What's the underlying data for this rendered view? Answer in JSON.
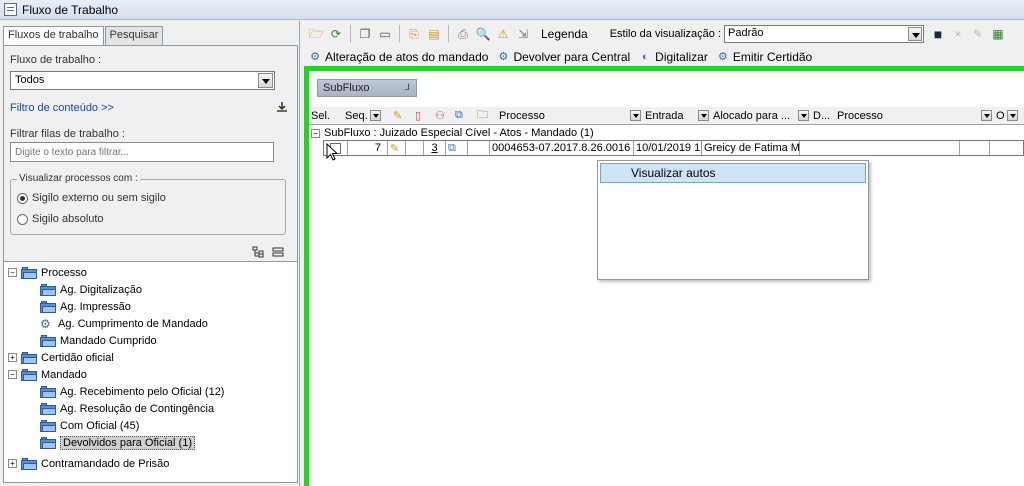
{
  "window": {
    "title": "Fluxo de Trabalho"
  },
  "left": {
    "tabs": [
      "Fluxos de trabalho",
      "Pesquisar"
    ],
    "flow_label": "Fluxo de trabalho :",
    "flow_value": "Todos",
    "content_filter_link": "Filtro de conteúdo >>",
    "filter_label": "Filtrar filas de trabalho :",
    "filter_placeholder": "Digite o texto para filtrar...",
    "visualize_group": "Visualizar processos com :",
    "radio_external": "Sigilo externo ou sem sigilo",
    "radio_absolute": "Sigilo absoluto"
  },
  "tree": {
    "processo": "Processo",
    "processo_children": [
      "Ag. Digitalização",
      "Ag. Impressão",
      "Ag. Cumprimento de Mandado",
      "Mandado Cumprido"
    ],
    "certidao": "Certidão oficial",
    "mandado": "Mandado",
    "mandado_children": [
      "Ag. Recebimento pelo Oficial (12)",
      "Ag. Resolução de Contingência",
      "Com Oficial (45)",
      "Devolvidos para Oficial (1)"
    ],
    "contramandado": "Contramandado de Prisão"
  },
  "toolbar": {
    "legend": "Legenda",
    "view_style_label": "Estilo da visualização :",
    "view_style_value": "Padrão"
  },
  "actions": [
    "Alteração de atos do mandado",
    "Devolver para Central",
    "Digitalizar",
    "Emitir Certidão"
  ],
  "grid": {
    "subflux_tab": "SubFluxo",
    "headers": {
      "sel": "Sel.",
      "seq": "Seq.",
      "processo": "Processo",
      "entrada": "Entrada",
      "alocado": "Alocado para ...",
      "d": "D...",
      "processo2": "Processo",
      "o": "O"
    },
    "group": "SubFluxo : Juizado Especial Cível - Atos - Mandado  (1)",
    "row": {
      "seq": "7",
      "docs": "3",
      "processo": "0004653-07.2017.8.26.0016",
      "entrada": "10/01/2019 1",
      "alocado": "Greicy de Fatima Ma"
    }
  },
  "context_menu": {
    "item": "Visualizar autos"
  },
  "colors": {
    "green_frame": "#22d322",
    "link": "#1a44b8",
    "folder": "#5b8fd0"
  }
}
